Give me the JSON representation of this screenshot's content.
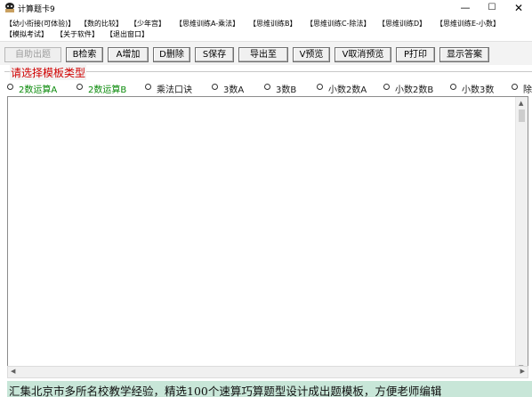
{
  "window": {
    "title": "计算题卡9",
    "min_glyph": "—",
    "max_glyph": "☐",
    "close_glyph": "✕"
  },
  "menu": {
    "row1": [
      "【幼小衔接(可体验)】",
      "【数的比较】",
      "【少年宫】",
      "【思维训练A-乘法】",
      "【思维训练B】",
      "【思维训练C-除法】",
      "【思维训练D】",
      "【思维训练E-小数】"
    ],
    "row2": [
      "【模拟考试】",
      "【关于软件】",
      "【退出窗口】"
    ]
  },
  "toolbar": {
    "buttons": [
      "自助出题",
      "B检索",
      "A增加",
      "D删除",
      "S保存",
      "导出至",
      "V预览",
      "V取消预览",
      "P打印",
      "显示答案"
    ]
  },
  "templates": {
    "legend": "请选择模板类型",
    "options": [
      "2数运算A",
      "2数运算B",
      "乘法口诀",
      "3数A",
      "3数B",
      "小数2数A",
      "小数2数B",
      "小数3数",
      "除"
    ]
  },
  "scroll": {
    "up": "▲",
    "down": "▼",
    "left": "◀",
    "right": "▶"
  },
  "footer": {
    "text": "汇集北京市多所名校教学经验，精选100个速算巧算题型设计成出题模板，方便老师编辑"
  },
  "colors": {
    "legend": "#d00000",
    "green_option": "#0a8a0a",
    "footer_bg": "#c8e6d8"
  }
}
